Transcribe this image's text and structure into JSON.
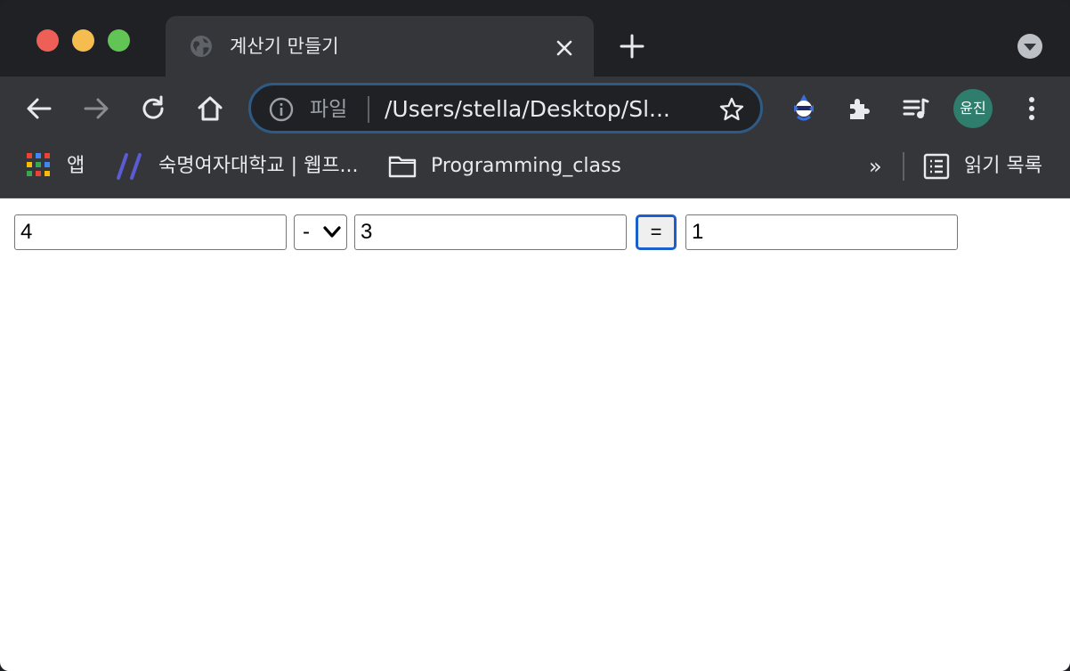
{
  "browser": {
    "tab": {
      "title": "계산기 만들기"
    },
    "omnibox": {
      "scheme_label": "파일",
      "url": "/Users/stella/Desktop/Sl..."
    },
    "profile": {
      "name": "윤진"
    },
    "bookmarks": {
      "apps_label": "앱",
      "items": [
        {
          "label": "숙명여자대학교 | 웹프..."
        },
        {
          "label": "Programming_class"
        }
      ],
      "overflow_label": "»",
      "reading_list_label": "읽기 목록"
    }
  },
  "calculator": {
    "operand1": "4",
    "operator": "-",
    "operand2": "3",
    "equals_label": "=",
    "result": "1"
  }
}
